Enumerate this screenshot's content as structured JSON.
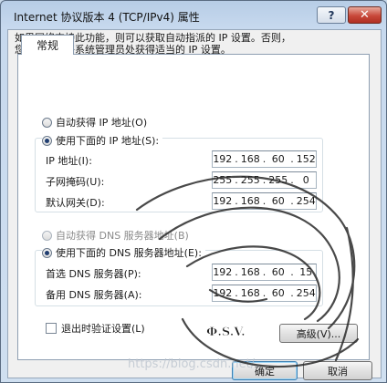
{
  "window": {
    "title": "Internet 协议版本 4 (TCP/IPv4) 属性",
    "help_label": "?",
    "close_label": "✕"
  },
  "tab": {
    "label": "常规"
  },
  "description": "如果网络支持此功能，则可以获取自动指派的 IP 设置。否则，\n您需要从网络系统管理员处获得适当的 IP 设置。",
  "ip_section": {
    "auto_label": "自动获得 IP 地址(O)",
    "manual_label": "使用下面的 IP 地址(S):",
    "selected": "manual",
    "fields": [
      {
        "label": "IP 地址(I):",
        "octets": [
          "192",
          "168",
          "60",
          "152"
        ]
      },
      {
        "label": "子网掩码(U):",
        "octets": [
          "255",
          "255",
          "255",
          "0"
        ]
      },
      {
        "label": "默认网关(D):",
        "octets": [
          "192",
          "168",
          "60",
          "254"
        ]
      }
    ]
  },
  "dns_section": {
    "auto_label": "自动获得 DNS 服务器地址(B)",
    "manual_label": "使用下面的 DNS 服务器地址(E):",
    "selected": "manual",
    "fields": [
      {
        "label": "首选 DNS 服务器(P):",
        "octets": [
          "192",
          "168",
          "60",
          "15"
        ]
      },
      {
        "label": "备用 DNS 服务器(A):",
        "octets": [
          "192",
          "168",
          "60",
          "254"
        ]
      }
    ]
  },
  "validate_checkbox": {
    "label": "退出时验证设置(L)",
    "checked": false
  },
  "buttons": {
    "advanced": "高级(V)...",
    "ok": "确定",
    "cancel": "取消"
  },
  "watermark": "https://blog.csdn.net/...",
  "sticker_text": "Ф.S.V."
}
